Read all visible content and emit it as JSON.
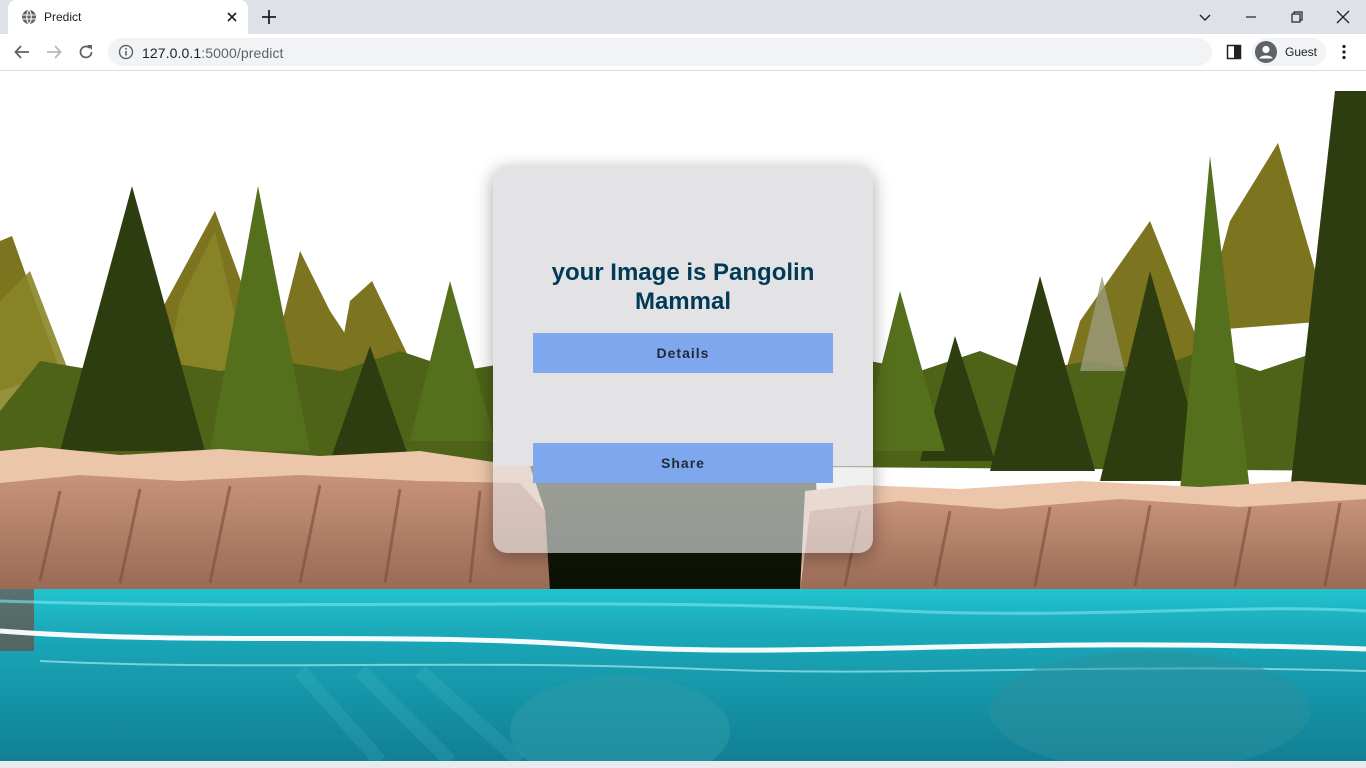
{
  "browser": {
    "tab_title": "Predict",
    "url_host": "127.0.0.1",
    "url_rest": ":5000/predict",
    "profile_name": "Guest"
  },
  "page": {
    "result_text": "your Image is Pangolin Mammal",
    "details_label": "Details",
    "share_label": "Share"
  },
  "colors": {
    "button": "#7fa7ee",
    "result_text": "#003a57",
    "water": "#1aa3b3"
  }
}
